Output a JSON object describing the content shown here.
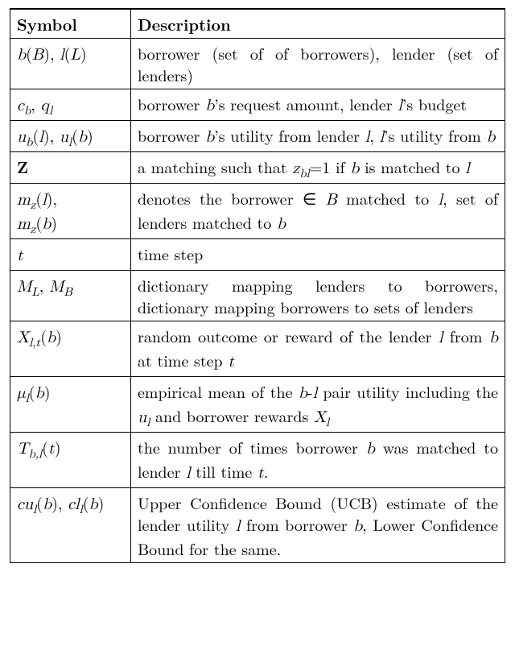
{
  "headers": {
    "symbol": "Symbol",
    "description": "Description"
  },
  "rows": [
    {
      "symbol": "<span class='math'>b</span>(<span class='cal'>B</span>), <span class='math'>l</span>(<span class='cal'>L</span>)",
      "description": "borrower (set of of borrowers), lender (set of lenders)"
    },
    {
      "symbol": "<span class='math'>c<sub>b</sub></span>, <span class='math'>q<sub>l</sub></span>",
      "description": "borrower <span class='math'>b</span>&rsquo;s request amount, lender <span class='math'>l</span>&rsquo;s budget"
    },
    {
      "symbol": "<span class='math'>u<sub>b</sub></span>(<span class='math'>l</span>), <span class='math'>u<sub>l</sub></span>(<span class='math'>b</span>)",
      "description": "borrower <span class='math'>b</span>&rsquo;s utility from lender <span class='math'>l</span>, <span class='math'>l</span>&rsquo;s utility from <span class='math'>b</span>"
    },
    {
      "symbol": "<span class='bold'>Z</span>",
      "description": "a matching such that <span class='math'>z<sub>bl</sub></span>=1 if <span class='math'>b</span> is matched to <span class='math'>l</span>"
    },
    {
      "symbol": "<span class='math'>m<sub>z</sub></span>(<span class='math'>l</span>),<br><span class='math'>m<sub>z</sub></span>(<span class='math'>b</span>)",
      "description": "denotes the borrower &isin; <span class='cal'>B</span> matched to <span class='math'>l</span>, set of lenders matched to <span class='math'>b</span>"
    },
    {
      "symbol": "<span class='math'>t</span>",
      "description": "time step"
    },
    {
      "symbol": "<span class='cal'>M<sub>L</sub></span>, <span class='cal'>M<sub>B</sub></span>",
      "description": "dictionary mapping lenders to borrowers, dictionary mapping borrowers to sets of lenders"
    },
    {
      "symbol": "<span class='math'>X<sub>l,t</sub></span>(<span class='math'>b</span>)",
      "description": "random outcome or reward of the lender <span class='math'>l</span> from <span class='math'>b</span> at time step <span class='math'>t</span>"
    },
    {
      "symbol": "<span class='math'>&mu;<sub>l</sub></span>(<span class='math'>b</span>)",
      "description": "empirical mean of the <span class='math'>b</span>-<span class='math'>l</span> pair utility including the <span class='math'>u<sub>l</sub></span> and borrower rewards <span class='math'>X<sub>l</sub></span>"
    },
    {
      "symbol": "<span class='math'>T<sub>b,l</sub></span>(<span class='math'>t</span>)",
      "description": "the number of times borrower <span class='math'>b</span> was matched to lender <span class='math'>l</span> till time <span class='math'>t</span>."
    },
    {
      "symbol": "<span class='math'>cu<sub>l</sub></span>(<span class='math'>b</span>), <span class='math'>cl<sub>l</sub></span>(<span class='math'>b</span>)",
      "description": "Upper Confidence Bound (UCB) estimate of the lender utility <span class='math'>l</span> from borrower <span class='math'>b</span>, Lower Confidence Bound for the same."
    }
  ]
}
